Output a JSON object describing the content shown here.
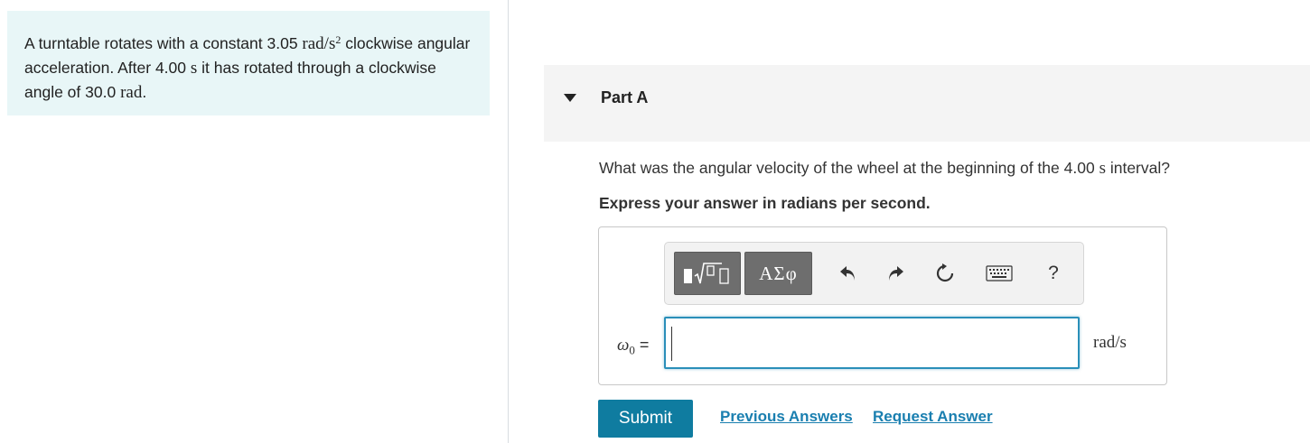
{
  "problem": {
    "text_1": "A turntable rotates with a constant 3.05 ",
    "accel_unit": "rad/s",
    "accel_exp": "2",
    "text_2": " clockwise angular acceleration. After 4.00 ",
    "time_unit": "s",
    "text_3": " it has rotated through a clockwise angle of 30.0 ",
    "angle_unit": "rad",
    "text_4": "."
  },
  "part": {
    "title": "Part A",
    "question_1": "What was the angular velocity of the wheel at the beginning of the 4.00 ",
    "question_unit": "s",
    "question_2": " interval?",
    "instruction": "Express your answer in radians per second."
  },
  "toolbar": {
    "greek_label": "ΑΣφ",
    "icons": [
      "templates-icon",
      "greek-letters",
      "undo-icon",
      "redo-icon",
      "reset-icon",
      "keyboard-icon",
      "help-icon"
    ],
    "help_label": "?"
  },
  "answer": {
    "variable": "ω",
    "subscript": "0",
    "equals": " =",
    "value": "",
    "unit": "rad/s"
  },
  "actions": {
    "submit": "Submit",
    "previous_answers": "Previous Answers",
    "request_answer": "Request Answer"
  },
  "colors": {
    "problem_bg": "#e8f6f7",
    "part_header_bg": "#f4f4f4",
    "submit_bg": "#0f7ca0",
    "link": "#1a7fb0",
    "input_border": "#2a8fb9"
  }
}
